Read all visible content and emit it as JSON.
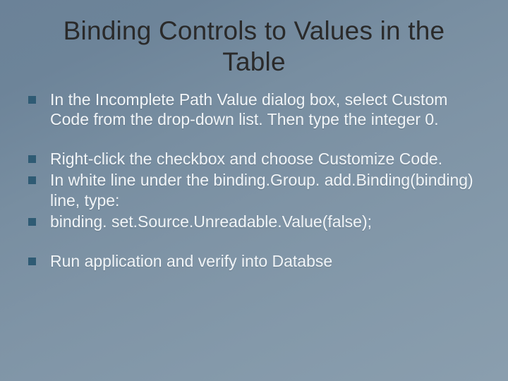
{
  "title": "Binding Controls to Values in the Table",
  "groups": [
    {
      "items": [
        "In the Incomplete Path Value dialog box, select Custom Code from the drop-down list. Then type the integer 0."
      ]
    },
    {
      "items": [
        "Right-click the checkbox and choose Customize Code.",
        "In white line under the binding.Group. add.Binding(binding) line, type:",
        "binding. set.Source.Unreadable.Value(false);"
      ]
    },
    {
      "items": [
        "Run application and verify into Databse"
      ]
    }
  ]
}
